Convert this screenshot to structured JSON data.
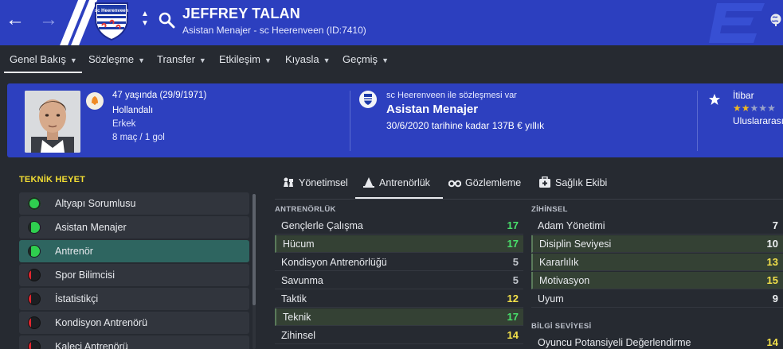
{
  "header": {
    "title": "JEFFREY TALAN",
    "subtitle": "Asistan Menajer - sc Heerenveen (ID:7410)",
    "club_badge_text": "sc Heerenveen"
  },
  "menu": [
    {
      "label": "Genel Bakış"
    },
    {
      "label": "Sözleşme"
    },
    {
      "label": "Transfer"
    },
    {
      "label": "Etkileşim"
    },
    {
      "label": "Kıyasla"
    },
    {
      "label": "Geçmiş"
    }
  ],
  "profile": {
    "age_dob": "47 yaşında (29/9/1971)",
    "nationality": "Hollandalı",
    "gender": "Erkek",
    "apps_goals": "8 maç / 1 gol",
    "contract_note": "sc Heerenveen ile sözleşmesi var",
    "role": "Asistan Menajer",
    "contract_expiry": "30/6/2020 tarihine kadar 137B € yıllık",
    "reputation_label": "İtibar",
    "reputation_stars": 1.5,
    "reputation_level": "Uluslararası"
  },
  "staff_panel": {
    "heading": "TEKNİK HEYET",
    "items": [
      {
        "label": "Altyapı Sorumlusu",
        "status": "full"
      },
      {
        "label": "Asistan Menajer",
        "status": "partial"
      },
      {
        "label": "Antrenör",
        "status": "partial",
        "selected": true
      },
      {
        "label": "Spor Bilimcisi",
        "status": "none"
      },
      {
        "label": "İstatistikçi",
        "status": "none"
      },
      {
        "label": "Kondisyon Antrenörü",
        "status": "none"
      },
      {
        "label": "Kaleci Antrenörü",
        "status": "none"
      }
    ]
  },
  "tabs": [
    {
      "label": "Yönetimsel",
      "icon": "chess-pieces-icon"
    },
    {
      "label": "Antrenörlük",
      "icon": "cone-icon",
      "active": true
    },
    {
      "label": "Gözlemleme",
      "icon": "binoculars-icon"
    },
    {
      "label": "Sağlık Ekibi",
      "icon": "medical-kit-icon"
    }
  ],
  "coaching": {
    "heading": "ANTRENÖRLÜK",
    "attributes": [
      {
        "name": "Gençlerle Çalışma",
        "value": "17",
        "color": "green"
      },
      {
        "name": "Hücum",
        "value": "17",
        "color": "green",
        "highlight": true
      },
      {
        "name": "Kondisyon Antrenörlüğü",
        "value": "5",
        "color": "grey"
      },
      {
        "name": "Savunma",
        "value": "5",
        "color": "grey"
      },
      {
        "name": "Taktik",
        "value": "12",
        "color": "yellow"
      },
      {
        "name": "Teknik",
        "value": "17",
        "color": "green",
        "highlight": true
      },
      {
        "name": "Zihinsel",
        "value": "14",
        "color": "yellow"
      }
    ]
  },
  "mental": {
    "heading": "ZİHİNSEL",
    "attributes": [
      {
        "name": "Adam Yönetimi",
        "value": "7",
        "color": "white"
      },
      {
        "name": "Disiplin Seviyesi",
        "value": "10",
        "color": "white",
        "highlight": true
      },
      {
        "name": "Kararlılık",
        "value": "13",
        "color": "yellow",
        "highlight": true
      },
      {
        "name": "Motivasyon",
        "value": "15",
        "color": "yellow",
        "highlight": true
      },
      {
        "name": "Uyum",
        "value": "9",
        "color": "white"
      }
    ]
  },
  "knowledge": {
    "heading": "BİLGİ SEVİYESİ",
    "attributes": [
      {
        "name": "Oyuncu Potansiyeli Değerlendirme",
        "value": "14",
        "color": "yellow"
      }
    ]
  },
  "colors": {
    "header_blue": "#2c3fbf",
    "background": "#262a31",
    "accent_yellow": "#f2dd33",
    "value_green": "#49e06b",
    "value_yellow": "#f2e04a",
    "selected_row": "#2e6560"
  }
}
